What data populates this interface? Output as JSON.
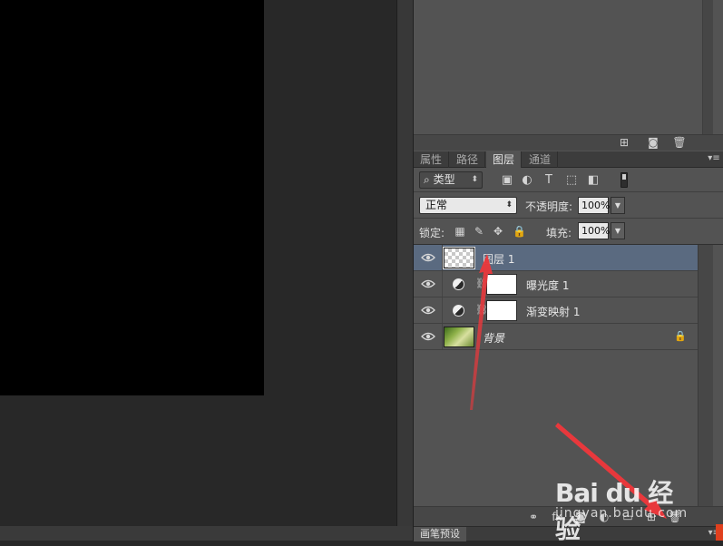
{
  "panel": {
    "tabs": [
      {
        "label": "属性",
        "active": false
      },
      {
        "label": "路径",
        "active": false
      },
      {
        "label": "图层",
        "active": true
      },
      {
        "label": "通道",
        "active": false
      }
    ],
    "filter": {
      "kind_label": "类型"
    },
    "blend_mode": "正常",
    "opacity_label": "不透明度:",
    "opacity_value": "100%",
    "lock_label": "锁定:",
    "fill_label": "填充:",
    "fill_value": "100%"
  },
  "layers": [
    {
      "name": "图层 1",
      "type": "pixel",
      "selected": true,
      "visible": true
    },
    {
      "name": "曝光度 1",
      "type": "adjustment",
      "selected": false,
      "visible": true
    },
    {
      "name": "渐变映射 1",
      "type": "adjustment",
      "selected": false,
      "visible": true
    },
    {
      "name": "背景",
      "type": "background",
      "selected": false,
      "visible": true,
      "locked": true
    }
  ],
  "bottom_panel": {
    "brush_tab_label": "画笔预设"
  },
  "icons": {
    "eye": "eye-icon",
    "search": "search-icon",
    "lock": "lock-icon",
    "link": "link-icon",
    "trash": "trash-icon",
    "camera": "camera-icon",
    "menu": "panel-menu-icon"
  },
  "colors": {
    "panel_bg": "#535353",
    "selection": "#5a6a80",
    "annotation_arrow": "#e8383c"
  },
  "watermark": {
    "brand": "Bai du 经验",
    "url": "jingyan.baidu.com"
  }
}
